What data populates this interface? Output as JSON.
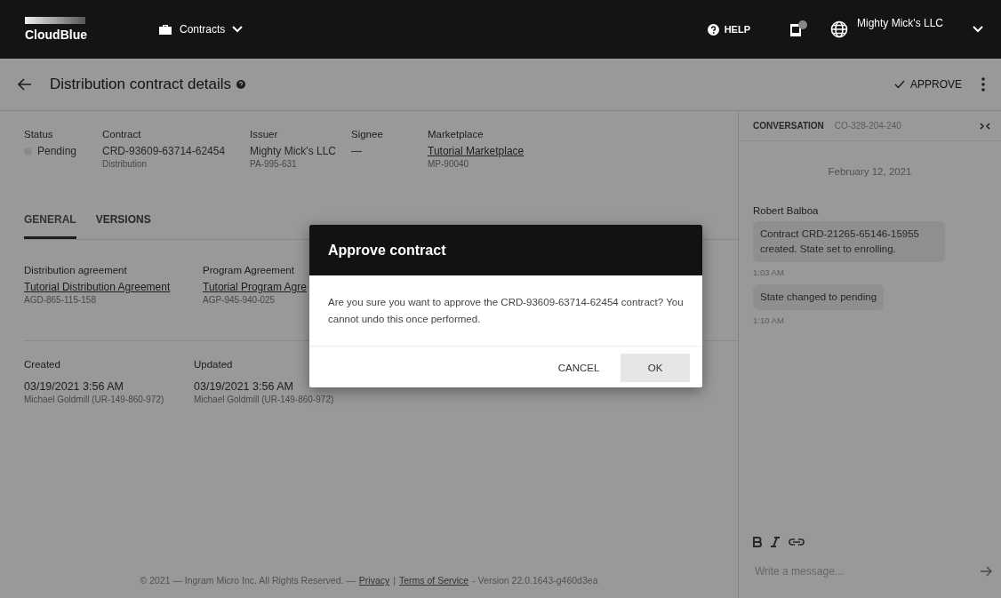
{
  "topbar": {
    "logo": "CloudBlue",
    "module": "Contracts",
    "help": "HELP",
    "account": "Mighty Mick's LLC"
  },
  "header": {
    "title": "Distribution contract details",
    "approve": "APPROVE"
  },
  "summary": [
    {
      "label": "Status",
      "value": "Pending",
      "kind": "status",
      "color": "#8a8a8a"
    },
    {
      "label": "Contract",
      "value": "CRD-93609-63714-62454",
      "sub": "Distribution",
      "kind": "text"
    },
    {
      "label": "Issuer",
      "value": "Mighty Mick's LLC",
      "sub": "PA-995-631",
      "kind": "text"
    },
    {
      "label": "Signee",
      "value": "—",
      "kind": "text"
    },
    {
      "label": "Marketplace",
      "value": "Tutorial Marketplace",
      "sub": "MP-90040",
      "kind": "link"
    }
  ],
  "tabs": [
    {
      "label": "GENERAL",
      "selected": true
    },
    {
      "label": "VERSIONS",
      "selected": false
    }
  ],
  "agreements": [
    {
      "label": "Distribution agreement",
      "link": "Tutorial Distribution Agreement",
      "id": "AGD-865-115-158"
    },
    {
      "label": "Program Agreement",
      "link": "Tutorial Program Agre",
      "id": "AGP-945-940-025"
    }
  ],
  "dates": [
    {
      "label": "Created",
      "date": "03/19/2021 3:56 AM",
      "user": "Michael Goldmill (UR-149-860-972)"
    },
    {
      "label": "Updated",
      "date": "03/19/2021 3:56 AM",
      "user": "Michael Goldmill (UR-149-860-972)"
    }
  ],
  "footer": {
    "copyright": "© 2021 — Ingram Micro Inc. All Rights Reserved. —",
    "privacy": "Privacy",
    "separator": "|",
    "terms": "Terms of Service",
    "version": "- Version 22.0.1643-g460d3ea"
  },
  "conversation": {
    "title": "CONVERSATION",
    "id": "CO-328-204-240",
    "date": "February 12, 2021",
    "author": "Robert Balboa",
    "messages": [
      {
        "text": "Contract CRD-21265-65146-15955 created. State set to enrolling.",
        "time": "1:03 AM"
      },
      {
        "text": "State changed to pending",
        "time": "1:10 AM"
      }
    ],
    "placeholder": "Write a message..."
  },
  "dialog": {
    "title": "Approve contract",
    "body": "Are you sure you want to approve the CRD-93609-63714-62454 contract? You cannot undo this once performed.",
    "cancel": "CANCEL",
    "ok": "OK"
  }
}
